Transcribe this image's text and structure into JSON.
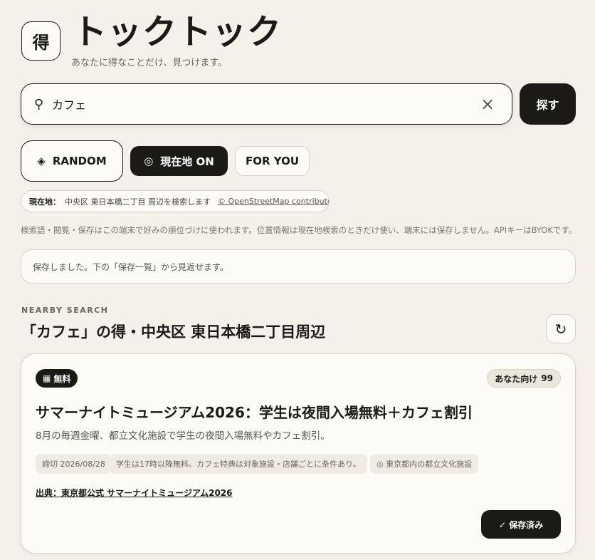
{
  "app": {
    "logo_char": "得",
    "title": "トックトック",
    "tagline": "あなたに得なことだけ、見つけます。"
  },
  "search": {
    "icon": "search-icon",
    "value": "カフェ",
    "placeholder": "",
    "clear_icon": "×",
    "button_label": "探す"
  },
  "modes": {
    "random": {
      "icon": "◈",
      "label": "RANDOM"
    },
    "location": {
      "icon": "◎",
      "label": "現在地 ON"
    },
    "foryou": {
      "label": "FOR YOU"
    }
  },
  "location_status": {
    "label": "現在地：",
    "text": "中央区 東日本橋二丁目 周辺を検索します",
    "credit": "© OpenStreetMap contributors"
  },
  "privacy_note": "検索語・閲覧・保存はこの端末で好みの順位づけに使われます。位置情報は現在地検索のときだけ使い、端末には保存しません。APIキーはBYOKです。",
  "toast": "保存しました。下の「保存一覧」から見返せます。",
  "section": {
    "kicker": "NEARBY SEARCH",
    "title": "「カフェ」の得・中央区 東日本橋二丁目周辺",
    "refresh_icon": "↻"
  },
  "card": {
    "badge_icon": "▦",
    "badge_label": "無料",
    "score_label": "あなた向け",
    "score_value": "99",
    "title": "サマーナイトミュージアム2026：学生は夜間入場無料＋カフェ割引",
    "description": "8月の毎週金曜、都立文化施設で学生の夜間入場無料やカフェ割引。",
    "tags": {
      "deadline": "締切 2026/08/28",
      "condition": "学生は17時以降無料。カフェ特典は対象施設・店舗ごとに条件あり。",
      "place": "◎ 東京都内の都立文化施設"
    },
    "source": "出典：東京都公式 サマーナイトミュージアム2026",
    "saved_label": "✓ 保存済み"
  },
  "colors": {
    "background": "#f4f1ea",
    "surface": "#fdfbf6",
    "ink": "#1b1a17",
    "muted": "#6b675e",
    "border": "#d6d2c8"
  }
}
